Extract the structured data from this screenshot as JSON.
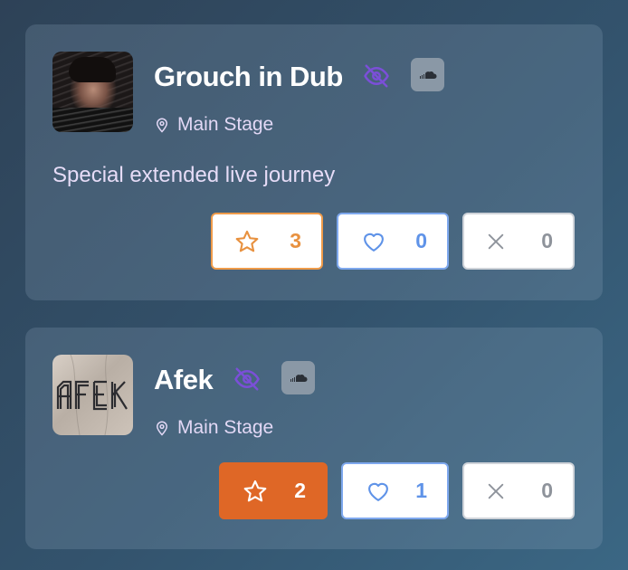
{
  "artists": [
    {
      "name": "Grouch in Dub",
      "location": "Main Stage",
      "description": "Special extended live journey",
      "icons": {
        "visibility": "eye-off-icon",
        "link": "soundcloud-icon"
      },
      "votes": {
        "star": "3",
        "heart": "0",
        "dismiss": "0"
      },
      "star_selected": false
    },
    {
      "name": "Afek",
      "location": "Main Stage",
      "description": "",
      "avatar_logo_text": "AFEK",
      "icons": {
        "visibility": "eye-off-icon",
        "link": "soundcloud-icon"
      },
      "votes": {
        "star": "2",
        "heart": "1",
        "dismiss": "0"
      },
      "star_selected": true
    }
  ],
  "colors": {
    "star_accent": "#e8913f",
    "star_selected_bg": "#df6726",
    "heart_accent": "#5f93e8",
    "eye_icon": "#7b4fd8",
    "location_text": "#e2d8f5"
  }
}
